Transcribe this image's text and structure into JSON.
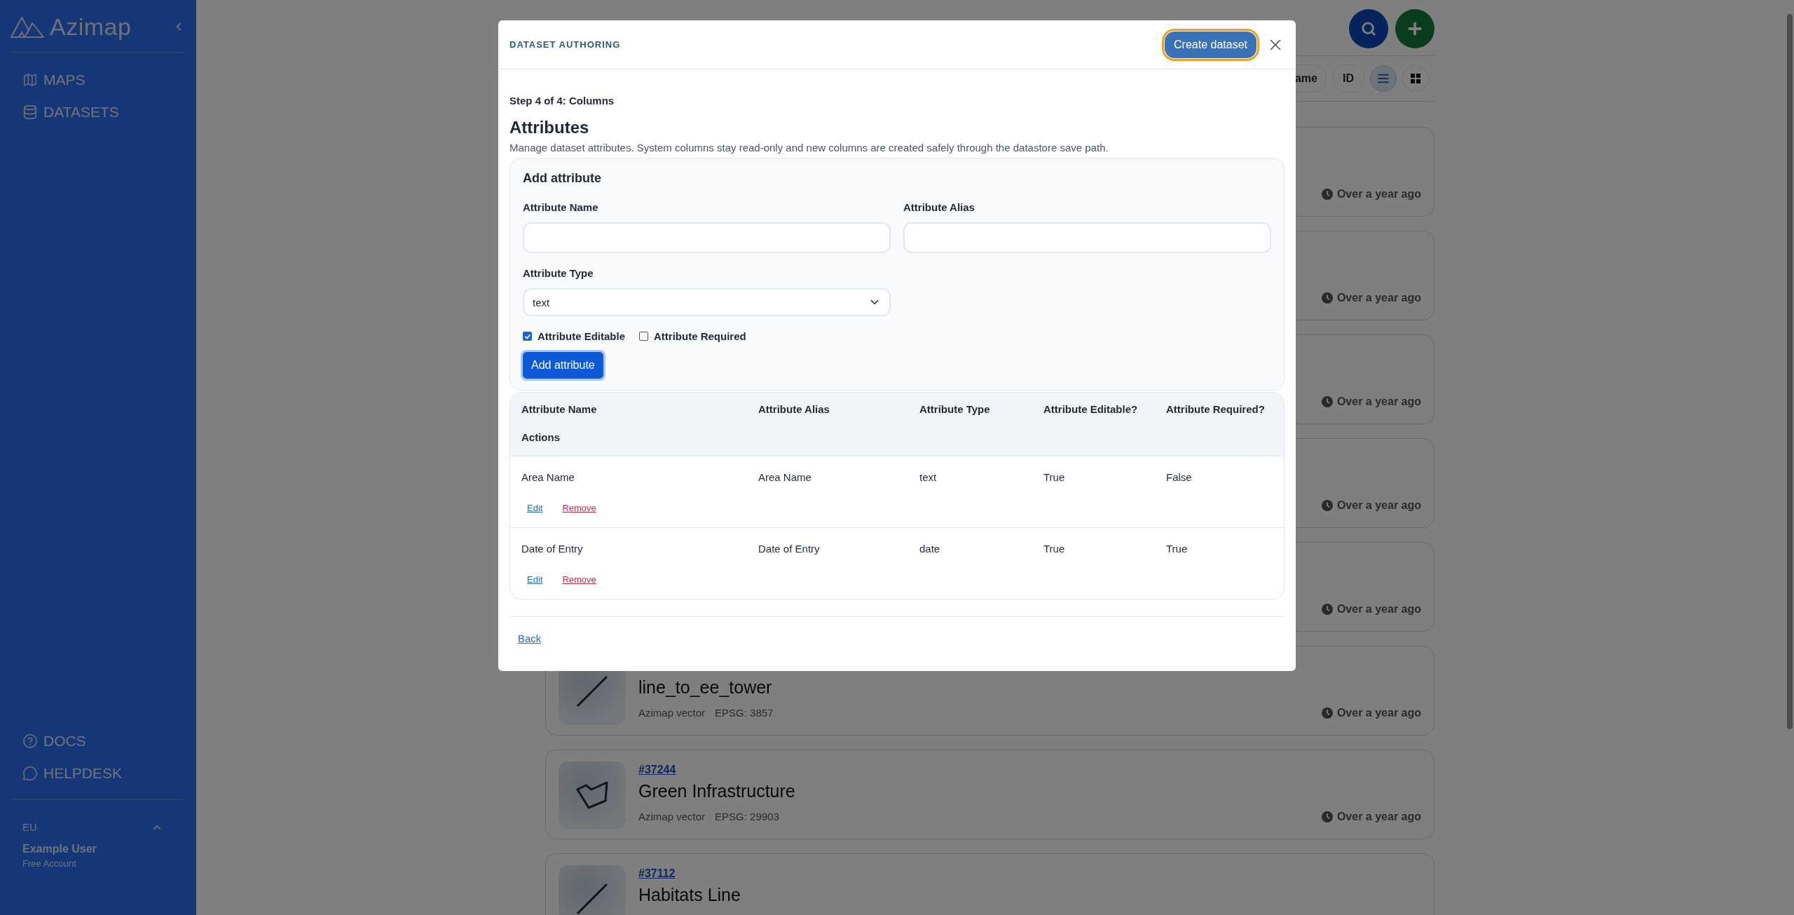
{
  "sidebar": {
    "brand": "Azimap",
    "nav": [
      {
        "label": "MAPS"
      },
      {
        "label": "DATASETS"
      }
    ],
    "help": [
      {
        "label": "DOCS"
      },
      {
        "label": "HELPDESK"
      }
    ],
    "region": "EU",
    "user": {
      "name": "Example User",
      "plan": "Free Account"
    }
  },
  "toolbar": {
    "sort_options": [
      {
        "label": "ame"
      },
      {
        "label": "ID"
      }
    ],
    "views": [
      {
        "kind": "list",
        "selected": true
      },
      {
        "kind": "grid",
        "selected": false
      }
    ]
  },
  "datasets": [
    {
      "time": "Over a year ago"
    },
    {
      "time": "Over a year ago"
    },
    {
      "time": "Over a year ago"
    },
    {
      "time": "Over a year ago"
    },
    {
      "time": "Over a year ago"
    },
    {
      "kind": "line",
      "title": "line_to_ee_tower",
      "meta": [
        "Azimap vector",
        "EPSG: 3857"
      ],
      "time": "Over a year ago"
    },
    {
      "kind": "polygon",
      "id": "#37244",
      "title": "Green Infrastructure",
      "meta": [
        "Azimap vector",
        "EPSG: 29903"
      ],
      "time": "Over a year ago"
    },
    {
      "kind": "line",
      "id": "#37112",
      "title": "Habitats Line"
    }
  ],
  "modal": {
    "eyebrow": "DATASET AUTHORING",
    "primary_button": "Create dataset",
    "step": "Step 4 of 4: Columns",
    "heading": "Attributes",
    "description": "Manage dataset attributes. System columns stay read-only and new columns are created safely through the datastore save path.",
    "form": {
      "title": "Add attribute",
      "fields": [
        {
          "label": "Attribute Name",
          "kind": "text"
        },
        {
          "label": "Attribute Alias",
          "kind": "text"
        },
        {
          "label": "Attribute Type",
          "kind": "select",
          "value": "text"
        }
      ],
      "checkboxes": [
        {
          "label": "Attribute Editable",
          "checked": true
        },
        {
          "label": "Attribute Required",
          "checked": false
        }
      ],
      "submit": "Add attribute"
    },
    "table": {
      "columns": [
        "Attribute Name",
        "Attribute Alias",
        "Attribute Type",
        "Attribute Editable?",
        "Attribute Required?",
        "Actions"
      ],
      "rows": [
        {
          "cells": [
            "Area Name",
            "Area Name",
            "text",
            "True",
            "False"
          ],
          "actions": [
            {
              "kind": "edit",
              "label": "Edit"
            },
            {
              "kind": "remove",
              "label": "Remove"
            }
          ]
        },
        {
          "cells": [
            "Date of Entry",
            "Date of Entry",
            "date",
            "True",
            "True"
          ],
          "actions": [
            {
              "kind": "edit",
              "label": "Edit"
            },
            {
              "kind": "remove",
              "label": "Remove"
            }
          ]
        }
      ]
    },
    "back": "Back"
  }
}
